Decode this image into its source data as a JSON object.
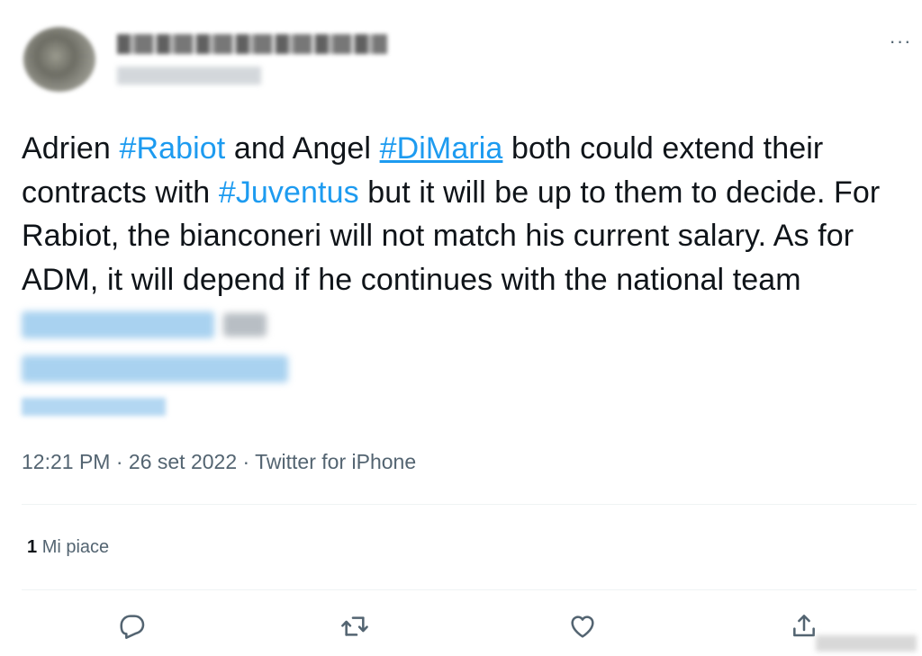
{
  "author": {
    "display_name": "",
    "handle": ""
  },
  "more_label": "···",
  "tweet": {
    "segments": [
      {
        "text": "Adrien ",
        "type": "text"
      },
      {
        "text": "#Rabiot",
        "type": "hashtag"
      },
      {
        "text": " and Angel ",
        "type": "text"
      },
      {
        "text": "#DiMaria",
        "type": "hashtag"
      },
      {
        "text": " both could extend their contracts with ",
        "type": "text"
      },
      {
        "text": "#Juventus",
        "type": "hashtag"
      },
      {
        "text": " but it will be up to them to decide. For Rabiot, the bianconeri will not match his current salary. As for ADM, it will depend if he continues with the national team",
        "type": "text"
      }
    ]
  },
  "meta": {
    "time": "12:21 PM",
    "separator": " · ",
    "date": "26 set 2022",
    "source": "Twitter for iPhone"
  },
  "likes": {
    "count": "1",
    "label": "Mi piace"
  },
  "actions": [
    {
      "name": "reply-icon"
    },
    {
      "name": "retweet-icon"
    },
    {
      "name": "like-icon"
    },
    {
      "name": "share-icon"
    }
  ],
  "colors": {
    "accent": "#1d9bf0",
    "text": "#0f1419",
    "secondary": "#536471",
    "divider": "#eff3f4"
  }
}
